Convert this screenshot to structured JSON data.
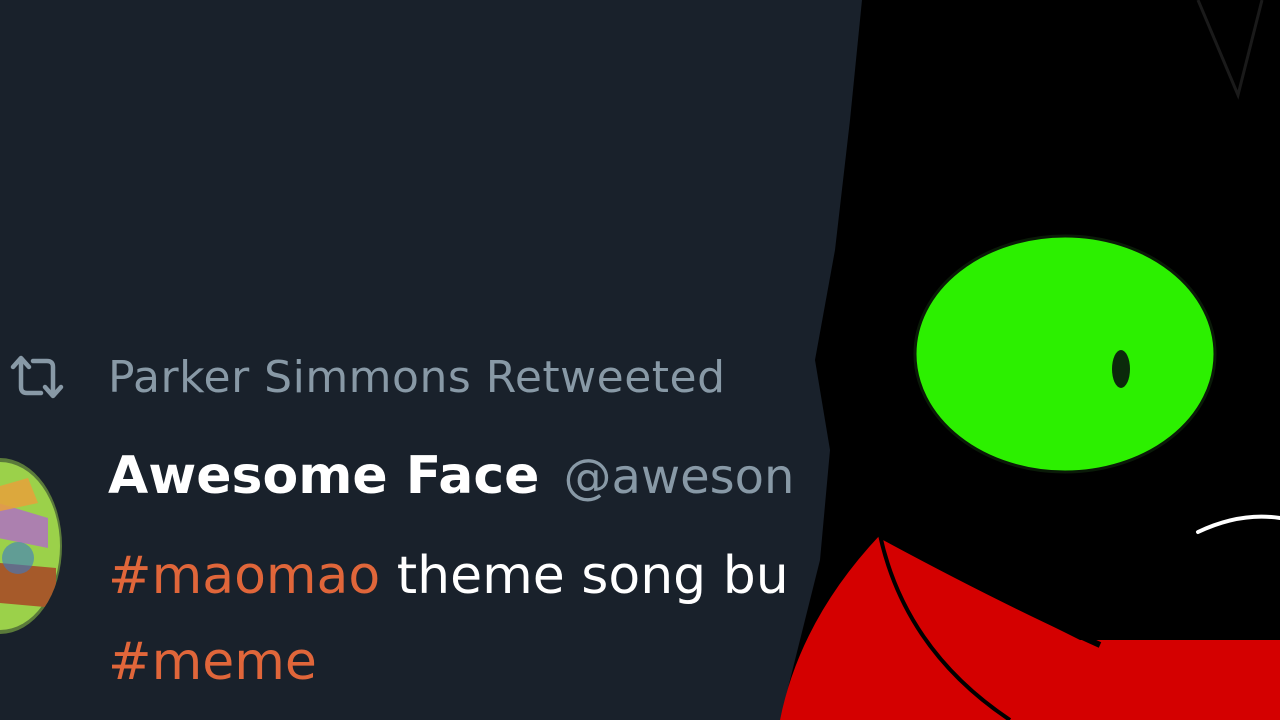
{
  "retweet": {
    "icon": "retweet-icon",
    "text": "Parker Simmons Retweeted"
  },
  "tweet": {
    "author_name": "Awesome Face",
    "author_handle": "@aweson",
    "text_line1": {
      "hashtag": "#maomao",
      "rest": " theme song bu"
    },
    "text_line2": {
      "hashtag": "#meme"
    }
  },
  "colors": {
    "background": "#19212b",
    "hashtag": "#e0663a",
    "muted": "#8899a6",
    "character_eye": "#2cf000",
    "character_shirt": "#d40000"
  }
}
